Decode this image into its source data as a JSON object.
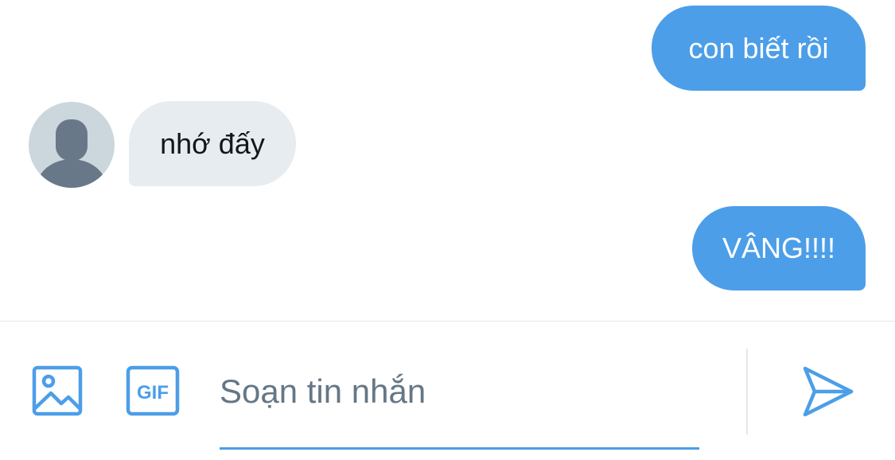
{
  "conversation": {
    "messages": [
      {
        "direction": "sent",
        "text": "con biết rồi"
      },
      {
        "direction": "received",
        "text": "nhớ đấy"
      },
      {
        "direction": "sent",
        "text": "VÂNG!!!!"
      }
    ],
    "avatar": {
      "icon": "default-user-silhouette-icon"
    }
  },
  "composer": {
    "media_icon": "image-icon",
    "gif_label": "GIF",
    "placeholder": "Soạn tin nhắn",
    "value": "",
    "send_icon": "send-icon"
  },
  "colors": {
    "accent": "#4c9ee8",
    "received_bubble": "#e6ecf0",
    "text_dark": "#14171a",
    "placeholder": "#657786",
    "avatar_bg": "#ccd6dd",
    "avatar_fg": "#687889"
  }
}
